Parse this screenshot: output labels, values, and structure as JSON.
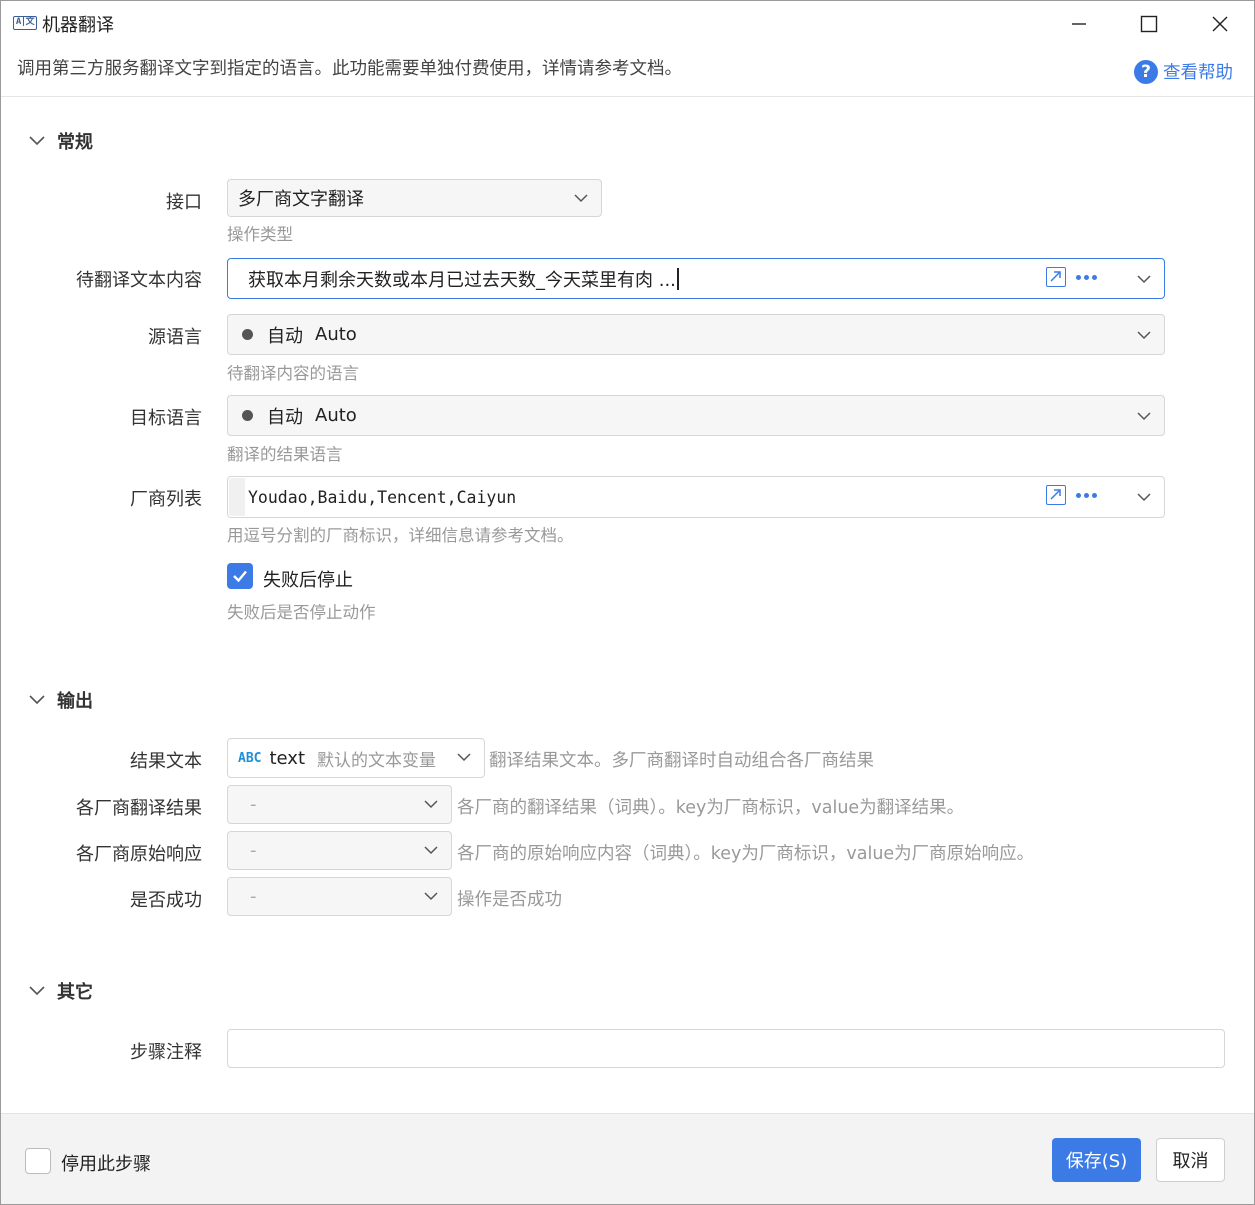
{
  "window": {
    "icon_text": "A|文",
    "title": "机器翻译",
    "subtitle": "调用第三方服务翻译文字到指定的语言。此功能需要单独付费使用，详情请参考文档。",
    "help_label": "查看帮助"
  },
  "sections": {
    "general": "常规",
    "output": "输出",
    "other": "其它"
  },
  "general": {
    "interface": {
      "label": "接口",
      "value": "多厂商文字翻译",
      "hint": "操作类型"
    },
    "source_text": {
      "label": "待翻译文本内容",
      "value": "获取本月剩余天数或本月已过去天数_今天菜里有肉 ..."
    },
    "source_lang": {
      "label": "源语言",
      "value": "自动",
      "sub": "Auto",
      "hint": "待翻译内容的语言"
    },
    "target_lang": {
      "label": "目标语言",
      "value": "自动",
      "sub": "Auto",
      "hint": "翻译的结果语言"
    },
    "vendors": {
      "label": "厂商列表",
      "value": "Youdao,Baidu,Tencent,Caiyun",
      "hint": "用逗号分割的厂商标识，详细信息请参考文档。"
    },
    "stop_on_fail": {
      "label": "失败后停止",
      "checked": true,
      "hint": "失败后是否停止动作"
    }
  },
  "output": {
    "result_text": {
      "label": "结果文本",
      "type_badge": "ABC",
      "var_name": "text",
      "var_desc": "默认的文本变量",
      "hint": "翻译结果文本。多厂商翻译时自动组合各厂商结果"
    },
    "vendor_results": {
      "label": "各厂商翻译结果",
      "value": "-",
      "hint": "各厂商的翻译结果（词典）。key为厂商标识，value为翻译结果。"
    },
    "vendor_raw": {
      "label": "各厂商原始响应",
      "value": "-",
      "hint": "各厂商的原始响应内容（词典）。key为厂商标识，value为厂商原始响应。"
    },
    "success": {
      "label": "是否成功",
      "value": "-",
      "hint": "操作是否成功"
    }
  },
  "other": {
    "step_note": {
      "label": "步骤注释",
      "value": ""
    }
  },
  "footer": {
    "disable_label": "停用此步骤",
    "disable_checked": false,
    "save_label": "保存(S)",
    "cancel_label": "取消"
  },
  "colors": {
    "accent": "#3c7be6",
    "hint": "#999999",
    "field_bg": "#f6f6f6"
  }
}
